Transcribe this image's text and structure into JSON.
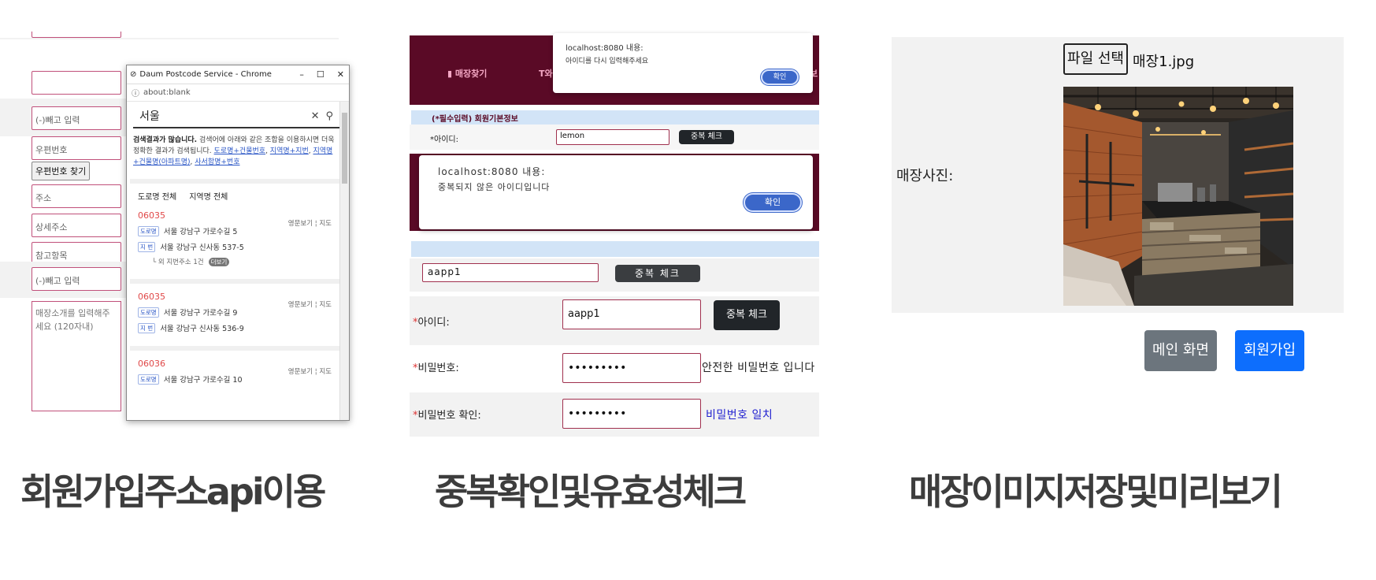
{
  "panel1": {
    "fields": {
      "field_empty": "",
      "phone_placeholder": "(-)빼고 입력",
      "postcode_placeholder": "우편번호",
      "postcode_button": "우편번호 찾기",
      "address_placeholder": "주소",
      "detail_address_placeholder": "상세주소",
      "reference_placeholder": "참고항목",
      "phone2_placeholder": "(-)빼고 입력",
      "intro_placeholder": "매장소개를 입력해주세요 (120자내)"
    },
    "popup": {
      "window_title": "Daum Postcode Service - Chrome",
      "url": "about:blank",
      "search_value": "서울",
      "message_bold": "검색결과가 많습니다.",
      "message_text": "검색어에 아래와 같은 조합을 이용하시면 더욱 정확한 결과가 검색됩니다.",
      "message_links": [
        "도로명+건물번호",
        "지역명+지번",
        "지역명+건물명(아파트명)",
        "사서함명+번호"
      ],
      "tabs": [
        "도로명 전체",
        "지역명 전체"
      ],
      "results": [
        {
          "zip": "06035",
          "road": "서울 강남구 가로수길 5",
          "jibun": "서울 강남구 신사동 537-5",
          "extra": "└ 외 지번주소 1건",
          "more": "더보기"
        },
        {
          "zip": "06035",
          "road": "서울 강남구 가로수길 9",
          "jibun": "서울 강남구 신사동 536-9"
        },
        {
          "zip": "06036",
          "road": "서울 강남구 가로수길 10"
        }
      ],
      "side_eng": "영문보기",
      "side_map": "지도",
      "tag_road": "도로명",
      "tag_jibun": "지 번"
    },
    "caption": "회원가입주소api이용"
  },
  "panel2": {
    "nav_items": [
      "매장찾기",
      "와",
      "보"
    ],
    "alert1": {
      "title": "localhost:8080 내용:",
      "message": "아이디를 다시 입력해주세요",
      "ok": "확인"
    },
    "section_header": "(*필수입력) 회원기본정보",
    "small_id_label": "*아이디:",
    "small_id_value": "lemon",
    "small_dup_button": "중복 체크",
    "alert2": {
      "title": "localhost:8080 내용:",
      "message": "중복되지 않은 아이디입니다",
      "ok": "확인"
    },
    "mid_id_value": "aapp1",
    "mid_dup_button": "중복 체크",
    "id_label_req": "*",
    "id_label": "아이디:",
    "id_value": "aapp1",
    "dup_button": "중복 체크",
    "pw_label": "비밀번호:",
    "pw_value": "•••••••••",
    "pw_status": "안전한 비밀번호 입니다",
    "pw_confirm_label": "비밀번호 확인:",
    "pw_confirm_value": "•••••••••",
    "pw_confirm_status": "비밀번호 일치",
    "pw_confirm_status_color": "#2020d0",
    "caption": "중복확인및유효성체크"
  },
  "panel3": {
    "file_button": "파일 선택",
    "file_name": "매장1.jpg",
    "photo_label": "매장사진:",
    "main_button": "메인 화면",
    "signup_button": "회원가입",
    "caption": "매장이미지저장및미리보기"
  },
  "colors": {
    "nav_bg": "#5a0a26",
    "input_border": "#a0304e",
    "dark_button": "#212529",
    "gray_button": "#6c757d",
    "blue_button": "#0d6efd"
  }
}
